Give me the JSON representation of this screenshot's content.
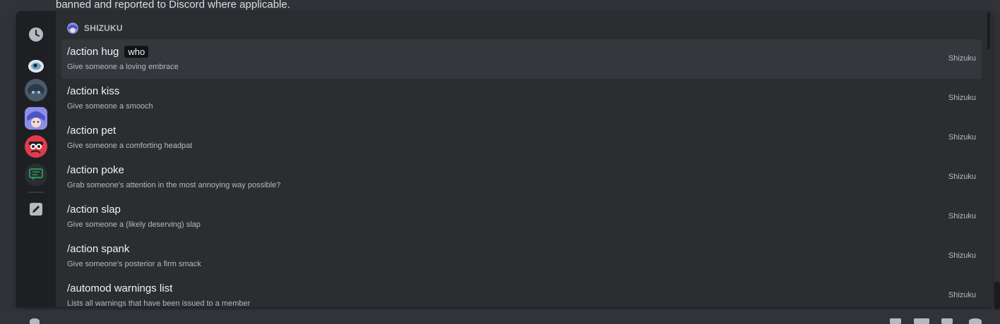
{
  "background": {
    "message_text": "banned and reported to Discord where applicable."
  },
  "rail": {
    "items": [
      {
        "name": "recent-icon"
      },
      {
        "name": "app-logo-1"
      },
      {
        "name": "app-avatar-2"
      },
      {
        "name": "app-avatar-shizuku"
      },
      {
        "name": "app-avatar-3"
      },
      {
        "name": "chat-icon"
      },
      {
        "name": "edit-icon"
      }
    ]
  },
  "section": {
    "title": "SHIZUKU"
  },
  "commands": [
    {
      "name": "/action hug",
      "option": "who",
      "description": "Give someone a loving embrace",
      "source": "Shizuku"
    },
    {
      "name": "/action kiss",
      "description": "Give someone a smooch",
      "source": "Shizuku"
    },
    {
      "name": "/action pet",
      "description": "Give someone a comforting headpat",
      "source": "Shizuku"
    },
    {
      "name": "/action poke",
      "description": "Grab someone's attention in the most annoying way possible?",
      "source": "Shizuku"
    },
    {
      "name": "/action slap",
      "description": "Give someone a (likely deserving) slap",
      "source": "Shizuku"
    },
    {
      "name": "/action spank",
      "description": "Give someone's posterior a firm smack",
      "source": "Shizuku"
    },
    {
      "name": "/automod warnings list",
      "description": "Lists all warnings that have been issued to a member",
      "source": "Shizuku"
    }
  ],
  "colors": {
    "background": "#313338",
    "popup": "#2b2d31",
    "rail": "#1e1f22",
    "selected": "#35373c",
    "accent": "#23a55a"
  }
}
